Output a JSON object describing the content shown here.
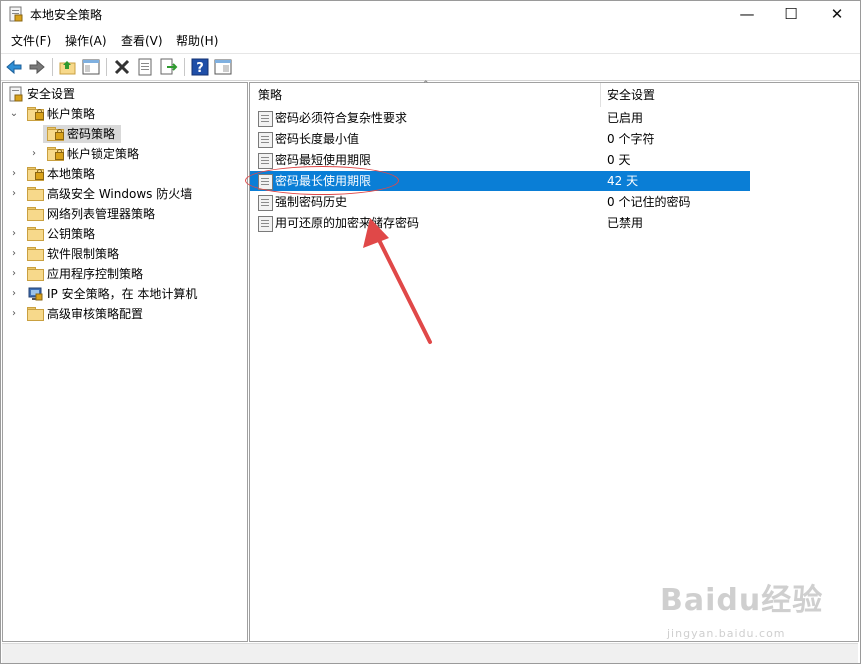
{
  "window": {
    "title": "本地安全策略",
    "caption_minimize": "—",
    "caption_maximize": "☐",
    "caption_close": "✕"
  },
  "menu": [
    {
      "label": "文件(F)"
    },
    {
      "label": "操作(A)"
    },
    {
      "label": "查看(V)"
    },
    {
      "label": "帮助(H)"
    }
  ],
  "toolbar": {
    "icons": [
      "back-icon",
      "forward-icon",
      "up-folder-icon",
      "show-tree-icon",
      "delete-icon",
      "properties-icon",
      "export-icon",
      "help-icon",
      "view-icon"
    ]
  },
  "tree": {
    "root": "安全设置",
    "items": [
      {
        "label": "帐户策略"
      },
      {
        "label": "密码策略"
      },
      {
        "label": "帐户锁定策略"
      },
      {
        "label": "本地策略"
      },
      {
        "label": "高级安全 Windows 防火墙"
      },
      {
        "label": "网络列表管理器策略"
      },
      {
        "label": "公钥策略"
      },
      {
        "label": "软件限制策略"
      },
      {
        "label": "应用程序控制策略"
      },
      {
        "label": "IP 安全策略，在 本地计算机"
      },
      {
        "label": "高级审核策略配置"
      }
    ]
  },
  "list": {
    "columns": [
      "策略",
      "安全设置"
    ],
    "rows": [
      {
        "name": "密码必须符合复杂性要求",
        "value": "已启用"
      },
      {
        "name": "密码长度最小值",
        "value": "0 个字符"
      },
      {
        "name": "密码最短使用期限",
        "value": "0 天"
      },
      {
        "name": "密码最长使用期限",
        "value": "42 天"
      },
      {
        "name": "强制密码历史",
        "value": "0 个记住的密码"
      },
      {
        "name": "用可还原的加密来储存密码",
        "value": "已禁用"
      }
    ],
    "selected_index": 3
  },
  "watermark": {
    "text": "Baidu经验",
    "sub": "jingyan.baidu.com"
  },
  "colors": {
    "selection": "#0a7ed6",
    "annotation": "#e04848"
  }
}
